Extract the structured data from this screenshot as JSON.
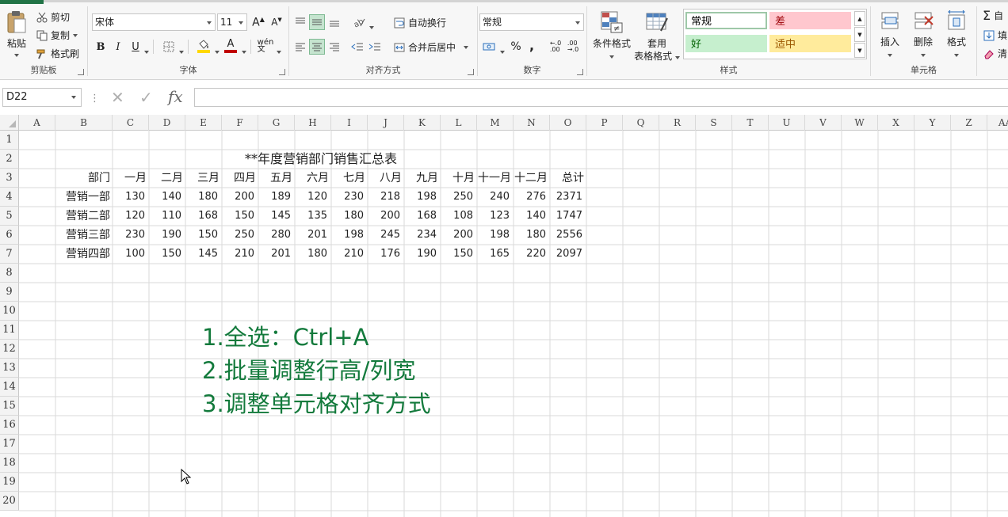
{
  "ribbon": {
    "clipboard": {
      "group_label": "剪贴板",
      "paste_label": "粘贴",
      "cut_label": "剪切",
      "copy_label": "复制",
      "format_painter_label": "格式刷"
    },
    "font": {
      "group_label": "字体",
      "font_name": "宋体",
      "font_size": "11",
      "bold_label": "B",
      "italic_label": "I",
      "underline_label": "U",
      "font_color": "#c00000",
      "fill_color": "#ffd800"
    },
    "alignment": {
      "group_label": "对齐方式",
      "wrap_text_label": "自动换行",
      "merge_center_label": "合并后居中"
    },
    "number": {
      "group_label": "数字",
      "format_value": "常规",
      "percent_label": "%",
      "comma_label": ","
    },
    "styles": {
      "group_label": "样式",
      "conditional_format_label": "条件格式",
      "table_format_label_1": "套用",
      "table_format_label_2": "表格格式",
      "cells": [
        {
          "label": "常规",
          "bg": "#ffffff",
          "fg": "#000000",
          "border": "#9ec8a8"
        },
        {
          "label": "差",
          "bg": "#ffc7ce",
          "fg": "#9c0006",
          "border": "#ffc7ce"
        },
        {
          "label": "好",
          "bg": "#c6efce",
          "fg": "#006100",
          "border": "#c6efce"
        },
        {
          "label": "适中",
          "bg": "#ffeb9c",
          "fg": "#9c5700",
          "border": "#ffeb9c"
        }
      ]
    },
    "cells_group": {
      "group_label": "单元格",
      "insert_label": "插入",
      "delete_label": "删除",
      "format_label": "格式"
    },
    "editing": {
      "autosum_label": "自",
      "fill_label": "填",
      "clear_label": "清"
    }
  },
  "formula_bar": {
    "name_box": "D22",
    "formula": "",
    "fx_label": "fx"
  },
  "sheet": {
    "columns": [
      "A",
      "B",
      "C",
      "D",
      "E",
      "F",
      "G",
      "H",
      "I",
      "J",
      "K",
      "L",
      "M",
      "N",
      "O",
      "P",
      "Q",
      "R",
      "S",
      "T",
      "U",
      "V",
      "W",
      "X",
      "Y",
      "Z",
      "AA"
    ],
    "rows": [
      "1",
      "2",
      "3",
      "4",
      "5",
      "6",
      "7",
      "8",
      "9",
      "10",
      "11",
      "12",
      "13",
      "14",
      "15",
      "16",
      "17",
      "18",
      "19",
      "20"
    ],
    "title": "**年度营销部门销售汇总表",
    "table_headers": [
      "部门",
      "一月",
      "二月",
      "三月",
      "四月",
      "五月",
      "六月",
      "七月",
      "八月",
      "九月",
      "十月",
      "十一月",
      "十二月",
      "总计"
    ],
    "table_rows": [
      [
        "营销一部",
        "130",
        "140",
        "180",
        "200",
        "189",
        "120",
        "230",
        "218",
        "198",
        "250",
        "240",
        "276",
        "2371"
      ],
      [
        "营销二部",
        "120",
        "110",
        "168",
        "150",
        "145",
        "135",
        "180",
        "200",
        "168",
        "108",
        "123",
        "140",
        "1747"
      ],
      [
        "营销三部",
        "230",
        "190",
        "150",
        "250",
        "280",
        "201",
        "198",
        "245",
        "234",
        "200",
        "198",
        "180",
        "2556"
      ],
      [
        "营销四部",
        "100",
        "150",
        "145",
        "210",
        "201",
        "180",
        "210",
        "176",
        "190",
        "150",
        "165",
        "220",
        "2097"
      ]
    ]
  },
  "annotations": [
    "1.全选：Ctrl+A",
    "2.批量调整行高/列宽",
    "3.调整单元格对齐方式"
  ]
}
